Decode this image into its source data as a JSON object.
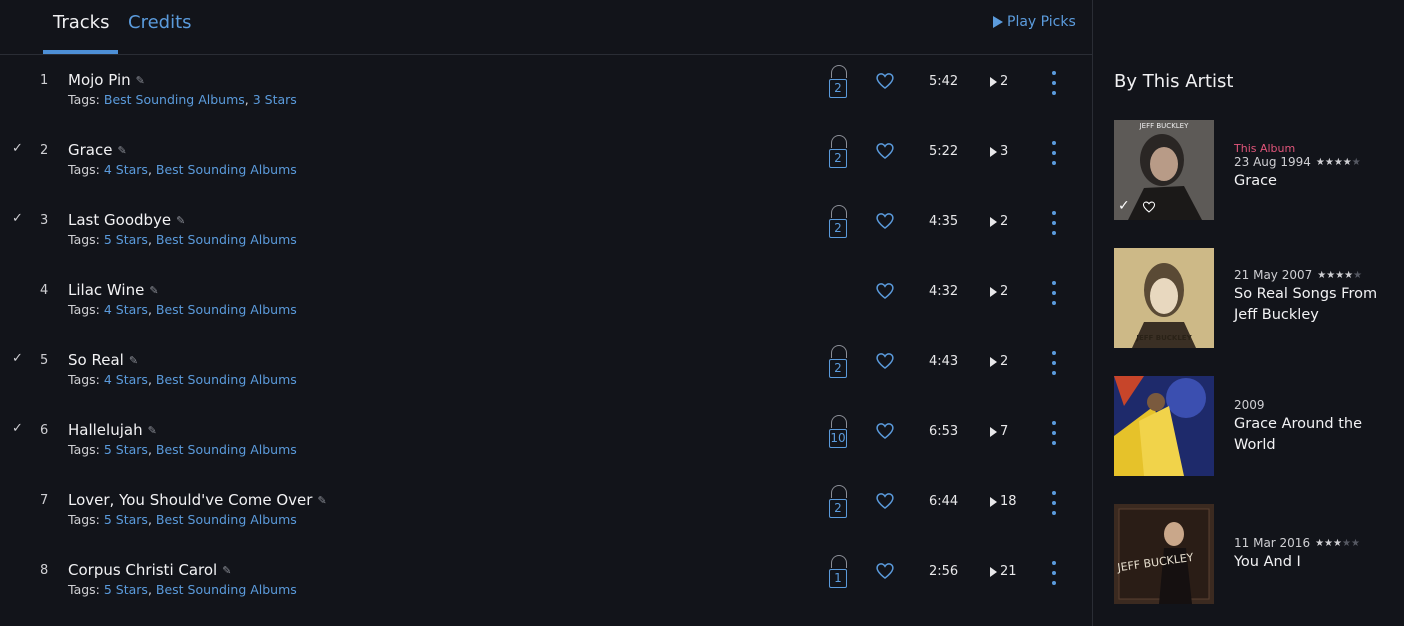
{
  "tabs": {
    "tracks": "Tracks",
    "credits": "Credits"
  },
  "play_picks": "Play Picks",
  "tags_prefix": "Tags:",
  "tracks": [
    {
      "checked": false,
      "num": "1",
      "title": "Mojo Pin",
      "tags": [
        "Best Sounding Albums",
        "3 Stars"
      ],
      "lock": "2",
      "duration": "5:42",
      "plays": "2"
    },
    {
      "checked": true,
      "num": "2",
      "title": "Grace",
      "tags": [
        "4 Stars",
        "Best Sounding Albums"
      ],
      "lock": "2",
      "duration": "5:22",
      "plays": "3"
    },
    {
      "checked": true,
      "num": "3",
      "title": "Last Goodbye",
      "tags": [
        "5 Stars",
        "Best Sounding Albums"
      ],
      "lock": "2",
      "duration": "4:35",
      "plays": "2"
    },
    {
      "checked": false,
      "num": "4",
      "title": "Lilac Wine",
      "tags": [
        "4 Stars",
        "Best Sounding Albums"
      ],
      "lock": null,
      "duration": "4:32",
      "plays": "2"
    },
    {
      "checked": true,
      "num": "5",
      "title": "So Real",
      "tags": [
        "4 Stars",
        "Best Sounding Albums"
      ],
      "lock": "2",
      "duration": "4:43",
      "plays": "2"
    },
    {
      "checked": true,
      "num": "6",
      "title": "Hallelujah",
      "tags": [
        "5 Stars",
        "Best Sounding Albums"
      ],
      "lock": "10",
      "duration": "6:53",
      "plays": "7"
    },
    {
      "checked": false,
      "num": "7",
      "title": "Lover, You Should've Come Over",
      "tags": [
        "5 Stars",
        "Best Sounding Albums"
      ],
      "lock": "2",
      "duration": "6:44",
      "plays": "18"
    },
    {
      "checked": false,
      "num": "8",
      "title": "Corpus Christi Carol",
      "tags": [
        "5 Stars",
        "Best Sounding Albums"
      ],
      "lock": "1",
      "duration": "2:56",
      "plays": "21"
    }
  ],
  "sidebar": {
    "title": "By This Artist",
    "albums": [
      {
        "label": "This Album",
        "date": "23 Aug 1994",
        "rating": 4,
        "name": "Grace",
        "cover_color": "#6d6a66"
      },
      {
        "label": "",
        "date": "21 May 2007",
        "rating": 3.5,
        "name": "So Real Songs From Jeff Buckley",
        "cover_color": "#cdb987",
        "cover_text": "JEFF BUCKLEY"
      },
      {
        "label": "",
        "date": "2009",
        "rating": 0,
        "name": "Grace Around the World",
        "cover_color": "#d6b52e"
      },
      {
        "label": "",
        "date": "11 Mar 2016",
        "rating": 3,
        "name": "You And I",
        "cover_color": "#3b2a20",
        "cover_text": "JEFF BUCKLEY"
      }
    ]
  },
  "colors": {
    "accent": "#5b9bdc",
    "this_album": "#e0557a",
    "background": "#12141a"
  }
}
